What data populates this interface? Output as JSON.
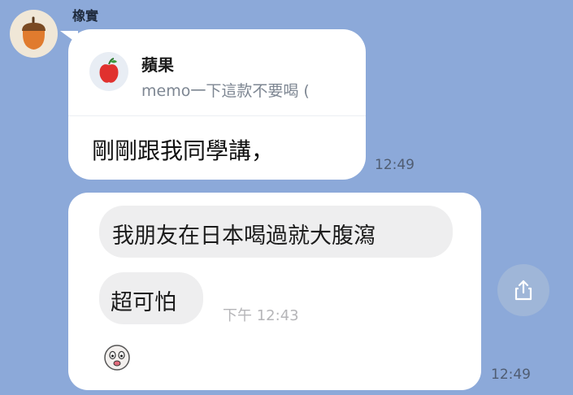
{
  "chat": {
    "sender_name": "橡實",
    "avatar_icon": "acorn-icon",
    "message1": {
      "reply": {
        "icon": "apple-icon",
        "name": "蘋果",
        "text": "memo一下這款不要喝 ("
      },
      "text": "剛剛跟我同學講，",
      "time": "12:49"
    },
    "message2": {
      "quoted_line1": "我朋友在日本喝過就大腹瀉",
      "quoted_line2": "超可怕",
      "quoted_time": "下午 12:43",
      "sticker_icon": "cartoon-face-sticker-icon",
      "time": "12:49"
    },
    "share_icon": "share-icon"
  },
  "colors": {
    "background": "#8ca9d9",
    "bubble": "#ffffff",
    "inner_bubble": "#eeeeef"
  }
}
